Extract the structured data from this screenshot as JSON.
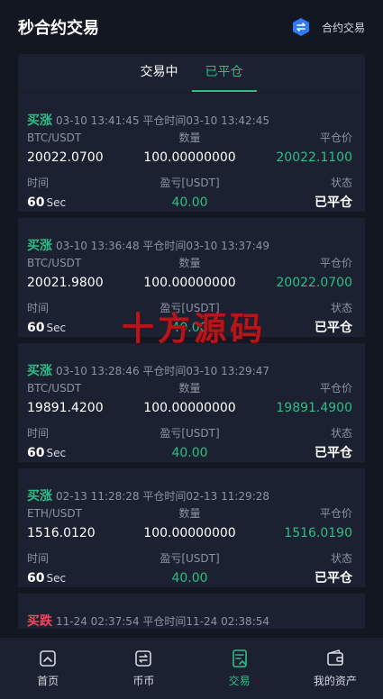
{
  "header": {
    "title": "秒合约交易",
    "right_label": "合约交易",
    "right_icon": "swap-logo-icon",
    "accent": "#2f7bf5"
  },
  "tabs": [
    {
      "label": "交易中",
      "active": false
    },
    {
      "label": "已平仓",
      "active": true
    }
  ],
  "colors": {
    "up": "#2ebd85",
    "down": "#f6465d",
    "background": "#131722",
    "panel": "#1b2130"
  },
  "labels": {
    "pair_label_qty": "数量",
    "close_price": "平仓价",
    "time": "时间",
    "pnl": "盈亏[USDT]",
    "status": "状态"
  },
  "orders": [
    {
      "direction": "买涨",
      "side": "up",
      "open_time": "03-10 13:41:45",
      "close_time_label": "平仓时间",
      "close_time": "03-10 13:42:45",
      "pair": "BTC/USDT",
      "price": "20022.0700",
      "quantity": "100.00000000",
      "close_price": "20022.1100",
      "duration": "60",
      "duration_unit": "Sec",
      "pnl": "40.00",
      "status": "已平仓"
    },
    {
      "direction": "买涨",
      "side": "up",
      "open_time": "03-10 13:36:48",
      "close_time_label": "平仓时间",
      "close_time": "03-10 13:37:49",
      "pair": "BTC/USDT",
      "price": "20021.9800",
      "quantity": "100.00000000",
      "close_price": "20022.0700",
      "duration": "60",
      "duration_unit": "Sec",
      "pnl": "40.00",
      "status": "已平仓"
    },
    {
      "direction": "买涨",
      "side": "up",
      "open_time": "03-10 13:28:46",
      "close_time_label": "平仓时间",
      "close_time": "03-10 13:29:47",
      "pair": "BTC/USDT",
      "price": "19891.4200",
      "quantity": "100.00000000",
      "close_price": "19891.4900",
      "duration": "60",
      "duration_unit": "Sec",
      "pnl": "40.00",
      "status": "已平仓"
    },
    {
      "direction": "买涨",
      "side": "up",
      "open_time": "02-13 11:28:28",
      "close_time_label": "平仓时间",
      "close_time": "02-13 11:29:28",
      "pair": "ETH/USDT",
      "price": "1516.0120",
      "quantity": "100.00000000",
      "close_price": "1516.0190",
      "duration": "60",
      "duration_unit": "Sec",
      "pnl": "40.00",
      "status": "已平仓"
    },
    {
      "direction": "买跌",
      "side": "down",
      "open_time": "11-24 02:37:54",
      "close_time_label": "平仓时间",
      "close_time": "11-24 02:38:54"
    }
  ],
  "watermark": "十方源码",
  "bottom_nav": [
    {
      "label": "首页",
      "icon": "home-icon",
      "active": false
    },
    {
      "label": "币币",
      "icon": "exchange-icon",
      "active": false
    },
    {
      "label": "交易",
      "icon": "trade-icon",
      "active": true
    },
    {
      "label": "我的资产",
      "icon": "wallet-icon",
      "active": false
    }
  ]
}
